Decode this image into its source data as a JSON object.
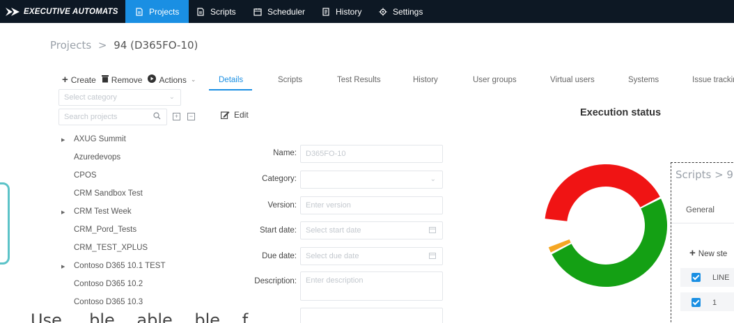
{
  "topbar": {
    "brand": "EXECUTIVE AUTOMATS",
    "nav": [
      {
        "label": "Projects"
      },
      {
        "label": "Scripts"
      },
      {
        "label": "Scheduler"
      },
      {
        "label": "History"
      },
      {
        "label": "Settings"
      }
    ],
    "active_color": "#1a8fe3",
    "bg_color": "#0d1824"
  },
  "breadcrumb": {
    "root": "Projects",
    "sep": ">",
    "current": "94 (D365FO-10)"
  },
  "left_panel": {
    "toolbar": {
      "create": "Create",
      "remove": "Remove",
      "actions": "Actions"
    },
    "category_placeholder": "Select category",
    "search_placeholder": "Search projects",
    "tree": [
      {
        "label": "AXUG Summit",
        "expandable": true
      },
      {
        "label": "Azuredevops",
        "expandable": false
      },
      {
        "label": "CPOS",
        "expandable": false
      },
      {
        "label": "CRM Sandbox Test",
        "expandable": false
      },
      {
        "label": "CRM Test Week",
        "expandable": true
      },
      {
        "label": "CRM_Pord_Tests",
        "expandable": false
      },
      {
        "label": "CRM_TEST_XPLUS",
        "expandable": false
      },
      {
        "label": "Contoso D365 10.1 TEST",
        "expandable": true
      },
      {
        "label": "Contoso D365 10.2",
        "expandable": false
      },
      {
        "label": "Contoso D365 10.3",
        "expandable": false
      }
    ]
  },
  "tabs": [
    "Details",
    "Scripts",
    "Test Results",
    "History",
    "User groups",
    "Virtual users",
    "Systems",
    "Issue trackin"
  ],
  "edit_label": "Edit",
  "form": {
    "name_label": "Name:",
    "name_value": "D365FO-10",
    "category_label": "Category:",
    "version_label": "Version:",
    "version_placeholder": "Enter version",
    "start_label": "Start date:",
    "start_placeholder": "Select start date",
    "due_label": "Due date:",
    "due_placeholder": "Select due date",
    "desc_label": "Description:",
    "desc_placeholder": "Enter description"
  },
  "chart": {
    "title": "Execution status",
    "colors": {
      "red": "#f01414",
      "green": "#14a014",
      "orange": "#f5a623"
    },
    "segments": [
      {
        "color": "red",
        "fraction": 0.41
      },
      {
        "color": "green",
        "fraction": 0.5
      },
      {
        "color": "orange",
        "fraction": 0.02
      }
    ]
  },
  "overlay": {
    "title": "Scripts > 9",
    "tab": "General",
    "new_step": "New ste",
    "rows": [
      {
        "label": "LINE"
      },
      {
        "label": "1"
      }
    ]
  },
  "bottom_text": "Use …     ble…     able…   ble…   f…"
}
